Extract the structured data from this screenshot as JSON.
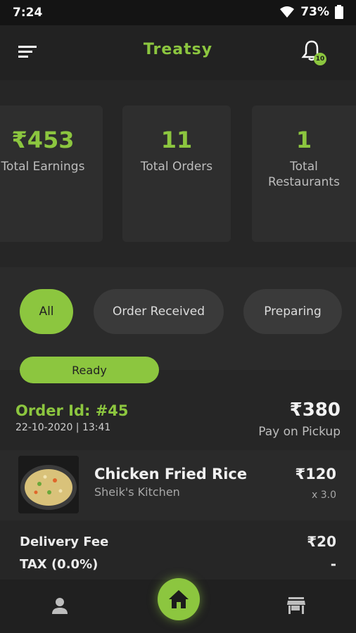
{
  "status_bar": {
    "time": "7:24",
    "battery": "73%"
  },
  "app_bar": {
    "title": "Treatsy",
    "notification_count": "10"
  },
  "stats": [
    {
      "value": "₹453",
      "label": "Total Earnings"
    },
    {
      "value": "11",
      "label": "Total Orders"
    },
    {
      "value": "1",
      "label_line1": "Total",
      "label_line2": "Restaurants"
    }
  ],
  "filters": {
    "chips": [
      "All",
      "Order Received",
      "Preparing"
    ],
    "ready": "Ready",
    "active": "All"
  },
  "order": {
    "id": "Order Id: #45",
    "datetime": "22-10-2020 | 13:41",
    "total": "₹380",
    "payment": "Pay on Pickup",
    "items": [
      {
        "name": "Chicken Fried Rice",
        "restaurant": "Sheik's Kitchen",
        "price": "₹120",
        "qty": "x 3.0"
      }
    ],
    "delivery_fee_label": "Delivery Fee",
    "delivery_fee": "₹20",
    "tax_label": "TAX (0.0%)",
    "tax": "-"
  },
  "colors": {
    "accent": "#8cc63f",
    "background": "#262626"
  },
  "icons": [
    "menu-icon",
    "bell-icon",
    "person-icon",
    "home-icon",
    "store-icon",
    "wifi-icon",
    "battery-icon"
  ]
}
